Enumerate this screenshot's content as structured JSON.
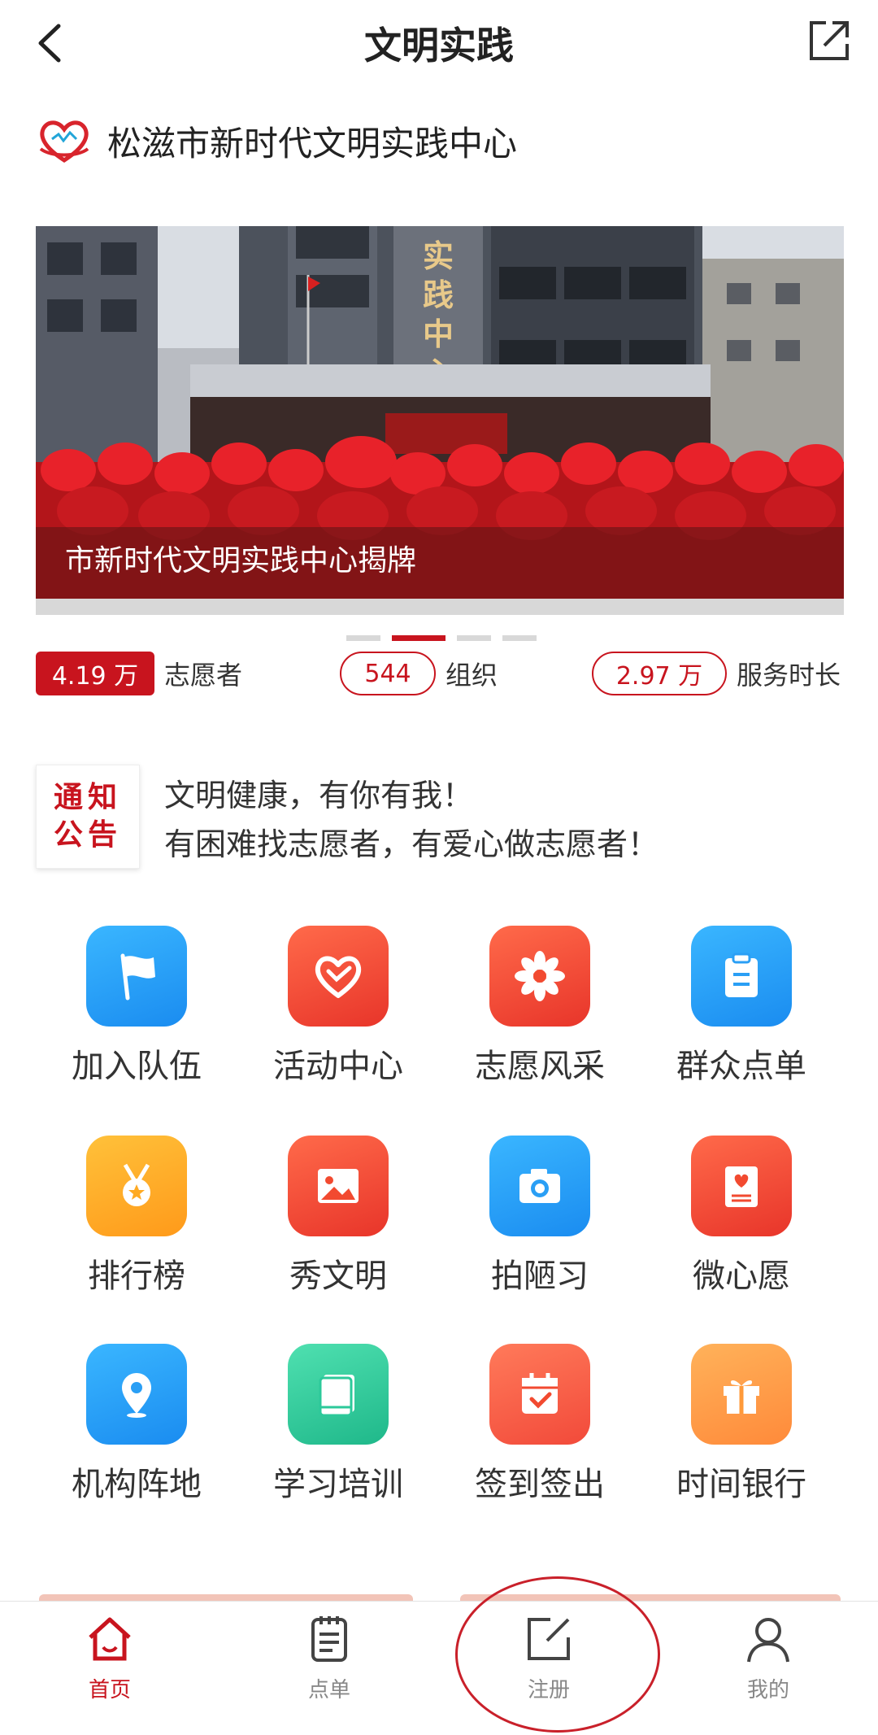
{
  "header": {
    "title": "文明实践"
  },
  "org": {
    "name": "松滋市新时代文明实践中心"
  },
  "banner": {
    "caption": "市新时代文明实践中心揭牌",
    "building_text": "实践中心"
  },
  "stats": [
    {
      "value": "4.19 万",
      "label": "志愿者"
    },
    {
      "value": "544",
      "label": "组织"
    },
    {
      "value": "2.97 万",
      "label": "服务时长"
    }
  ],
  "notice": {
    "badge_line1": "通知",
    "badge_line2": "公告",
    "line1": "文明健康，有你有我！",
    "line2": "有困难找志愿者，有爱心做志愿者！"
  },
  "grid": [
    {
      "label": "加入队伍",
      "icon": "flag-icon",
      "color": "#2a9ff5"
    },
    {
      "label": "活动中心",
      "icon": "heart-hand-icon",
      "color": "#f24a30"
    },
    {
      "label": "志愿风采",
      "icon": "flower-icon",
      "color": "#f24a30"
    },
    {
      "label": "群众点单",
      "icon": "clipboard-icon",
      "color": "#2a9ff5"
    },
    {
      "label": "排行榜",
      "icon": "medal-icon",
      "color": "#ffaa22"
    },
    {
      "label": "秀文明",
      "icon": "image-icon",
      "color": "#f24a30"
    },
    {
      "label": "拍陋习",
      "icon": "camera-icon",
      "color": "#2a9ff5"
    },
    {
      "label": "微心愿",
      "icon": "wish-card-icon",
      "color": "#f24a30"
    },
    {
      "label": "机构阵地",
      "icon": "location-pin-icon",
      "color": "#2a9ff5"
    },
    {
      "label": "学习培训",
      "icon": "book-icon",
      "color": "#2cc99a"
    },
    {
      "label": "签到签出",
      "icon": "calendar-check-icon",
      "color": "#f24a30"
    },
    {
      "label": "时间银行",
      "icon": "gift-icon",
      "color": "#ff9a3a"
    }
  ],
  "tabs": [
    {
      "label": "首页",
      "icon": "home-icon",
      "active": true
    },
    {
      "label": "点单",
      "icon": "order-list-icon",
      "active": false
    },
    {
      "label": "注册",
      "icon": "register-icon",
      "active": false
    },
    {
      "label": "我的",
      "icon": "user-icon",
      "active": false
    }
  ],
  "colors": {
    "accent": "#c8141e",
    "text": "#333333"
  }
}
